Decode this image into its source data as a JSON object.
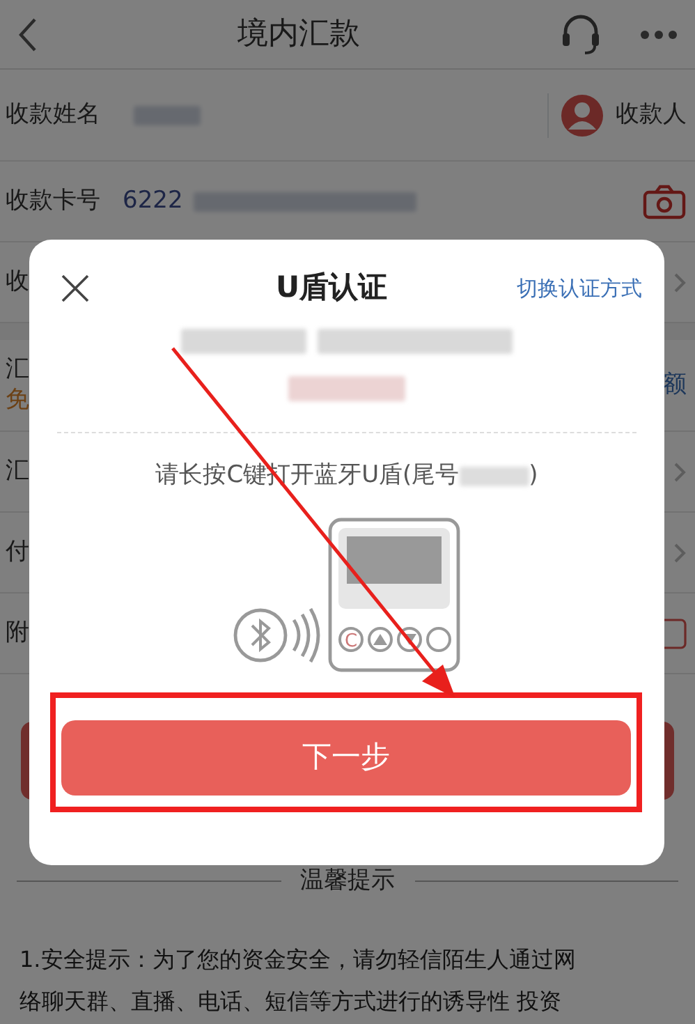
{
  "header": {
    "title": "境内汇款"
  },
  "form": {
    "rows": [
      {
        "kind": "name",
        "label": "收款姓名",
        "action": "收款人"
      },
      {
        "kind": "card",
        "label": "收款卡号",
        "value": "6222"
      },
      {
        "kind": "chevron",
        "label": "收"
      },
      {
        "kind": "amount",
        "label": "汇",
        "note": "免",
        "link": "额"
      },
      {
        "kind": "chevron",
        "label": "汇"
      },
      {
        "kind": "chevron",
        "label": "付"
      },
      {
        "kind": "checkbox",
        "label": "附",
        "checked": false
      }
    ]
  },
  "tips": {
    "title": "温馨提示",
    "lines": [
      "1.安全提示：为了您的资金安全，请勿轻信陌生人通过网",
      "络聊天群、直播、电话、短信等方式进行的诱导性 投资"
    ]
  },
  "dialog": {
    "title": "U盾认证",
    "switch_link": "切换认证方式",
    "instruction": "请长按C键打开蓝牙U盾(尾号",
    "instruction_end": ")",
    "next_button": "下一步",
    "device_key": "C"
  }
}
